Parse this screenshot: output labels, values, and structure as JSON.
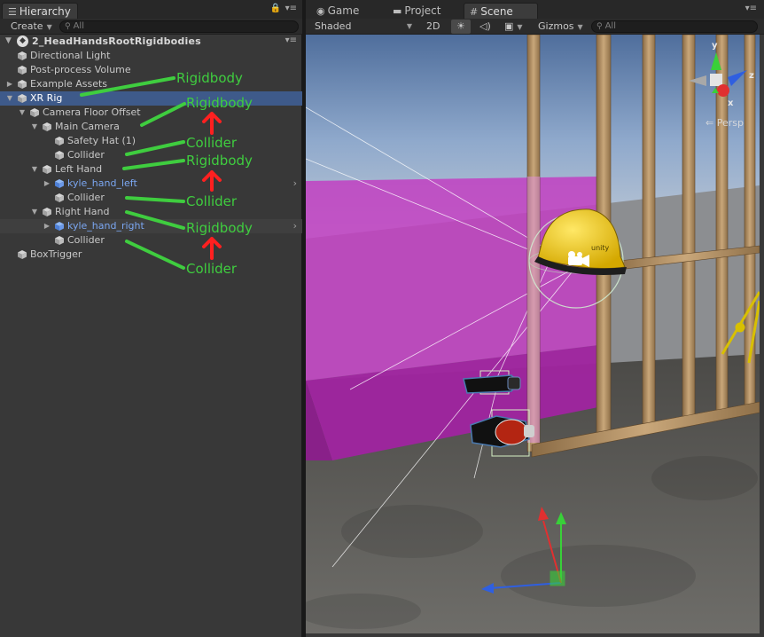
{
  "hierarchy": {
    "tab_label": "Hierarchy",
    "create_label": "Create",
    "search_placeholder": "All",
    "scene_name": "2_HeadHandsRootRigidbodies",
    "items": [
      {
        "label": "Directional Light"
      },
      {
        "label": "Post-process Volume"
      },
      {
        "label": "Example Assets"
      },
      {
        "label": "XR Rig"
      },
      {
        "label": "Camera Floor Offset"
      },
      {
        "label": "Main Camera"
      },
      {
        "label": "Safety Hat (1)"
      },
      {
        "label": "Collider"
      },
      {
        "label": "Left Hand"
      },
      {
        "label": "kyle_hand_left"
      },
      {
        "label": "Collider"
      },
      {
        "label": "Right Hand"
      },
      {
        "label": "kyle_hand_right"
      },
      {
        "label": "Collider"
      },
      {
        "label": "BoxTrigger"
      }
    ],
    "annotations": [
      "Rigidbody",
      "Rigidbody",
      "Collider",
      "Rigidbody",
      "Collider",
      "Rigidbody",
      "Collider"
    ]
  },
  "scene": {
    "tabs": [
      {
        "label": "Game",
        "icon": "game-controller-icon"
      },
      {
        "label": "Project",
        "icon": "folder-icon"
      },
      {
        "label": "Scene",
        "icon": "grid-icon"
      }
    ],
    "shading_label": "Shaded",
    "twod_label": "2D",
    "gizmos_label": "Gizmos",
    "search_placeholder": "All",
    "persp_label": "Persp",
    "axis_labels": {
      "x": "x",
      "y": "y",
      "z": "z"
    }
  },
  "colors": {
    "annotation_green": "#3fcd3f",
    "annotation_arrow": "#ff2020",
    "selection": "#3e5a8a",
    "prefab_text": "#7ba7f2",
    "trigger_volume": "#c23fc2"
  }
}
